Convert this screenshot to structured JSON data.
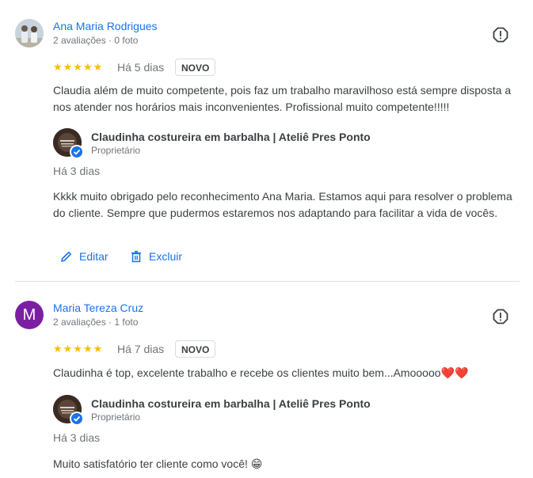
{
  "reviews": [
    {
      "author": "Ana Maria Rodrigues",
      "meta": "2 avaliações · 0 foto",
      "avatar_letter": "",
      "stars": "★★★★★",
      "rating": 5,
      "date": "Há 5 dias",
      "badge": "NOVO",
      "text": "Claudia além de muito competente, pois faz um trabalho maravilhoso está sempre disposta a nos atender nos horários mais inconvenientes. Profissional muito competente!!!!!",
      "reply": {
        "owner": "Claudinha costureira em barbalha | Ateliê Pres Ponto",
        "role": "Proprietário",
        "date": "Há 3 dias",
        "text": "Kkkk muito obrigado pelo reconhecimento Ana Maria. Estamos aqui para resolver o problema do cliente. Sempre que pudermos estaremos nos adaptando para facilitar a vida de vocês."
      },
      "actions": {
        "edit": "Editar",
        "delete": "Excluir"
      }
    },
    {
      "author": "Maria Tereza Cruz",
      "meta": "2 avaliações · 1 foto",
      "avatar_letter": "M",
      "stars": "★★★★★",
      "rating": 5,
      "date": "Há 7 dias",
      "badge": "NOVO",
      "text": "Claudinha é top, excelente trabalho e recebe os clientes muito bem...Amooooo❤️❤️",
      "reply": {
        "owner": "Claudinha costureira em barbalha | Ateliê Pres Ponto",
        "role": "Proprietário",
        "date": "Há 3 dias",
        "text": "Muito satisfatório ter cliente como você! 😁"
      }
    }
  ],
  "colors": {
    "link": "#1a73e8",
    "star": "#fbbc04",
    "avatar_purple": "#7b1fa2"
  },
  "icons": {
    "flag": "report-flag-icon",
    "edit": "pencil-icon",
    "delete": "trash-icon",
    "verified": "verified-check-icon"
  }
}
